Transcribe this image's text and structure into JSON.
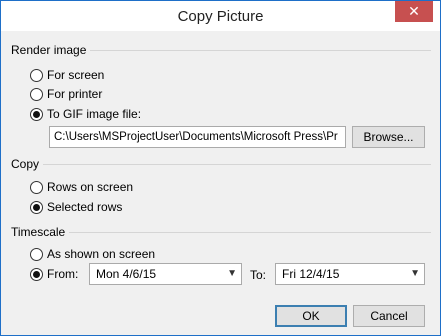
{
  "window": {
    "title": "Copy Picture",
    "close_glyph": "✕"
  },
  "render_image": {
    "header": "Render image",
    "options": [
      {
        "label": "For screen",
        "checked": false
      },
      {
        "label": "For printer",
        "checked": false
      },
      {
        "label": "To GIF image file:",
        "checked": true
      }
    ],
    "file_path": "C:\\Users\\MSProjectUser\\Documents\\Microsoft Press\\Pr",
    "browse_label": "Browse..."
  },
  "copy": {
    "header": "Copy",
    "options": [
      {
        "label": "Rows on screen",
        "checked": false
      },
      {
        "label": "Selected rows",
        "checked": true
      }
    ]
  },
  "timescale": {
    "header": "Timescale",
    "as_shown_label": "As shown on screen",
    "from_label": "From:",
    "from_value": "Mon 4/6/15",
    "to_label": "To:",
    "to_value": "Fri 12/4/15"
  },
  "buttons": {
    "ok": "OK",
    "cancel": "Cancel"
  },
  "icons": {
    "dropdown_arrow": "chevron-down-icon"
  }
}
